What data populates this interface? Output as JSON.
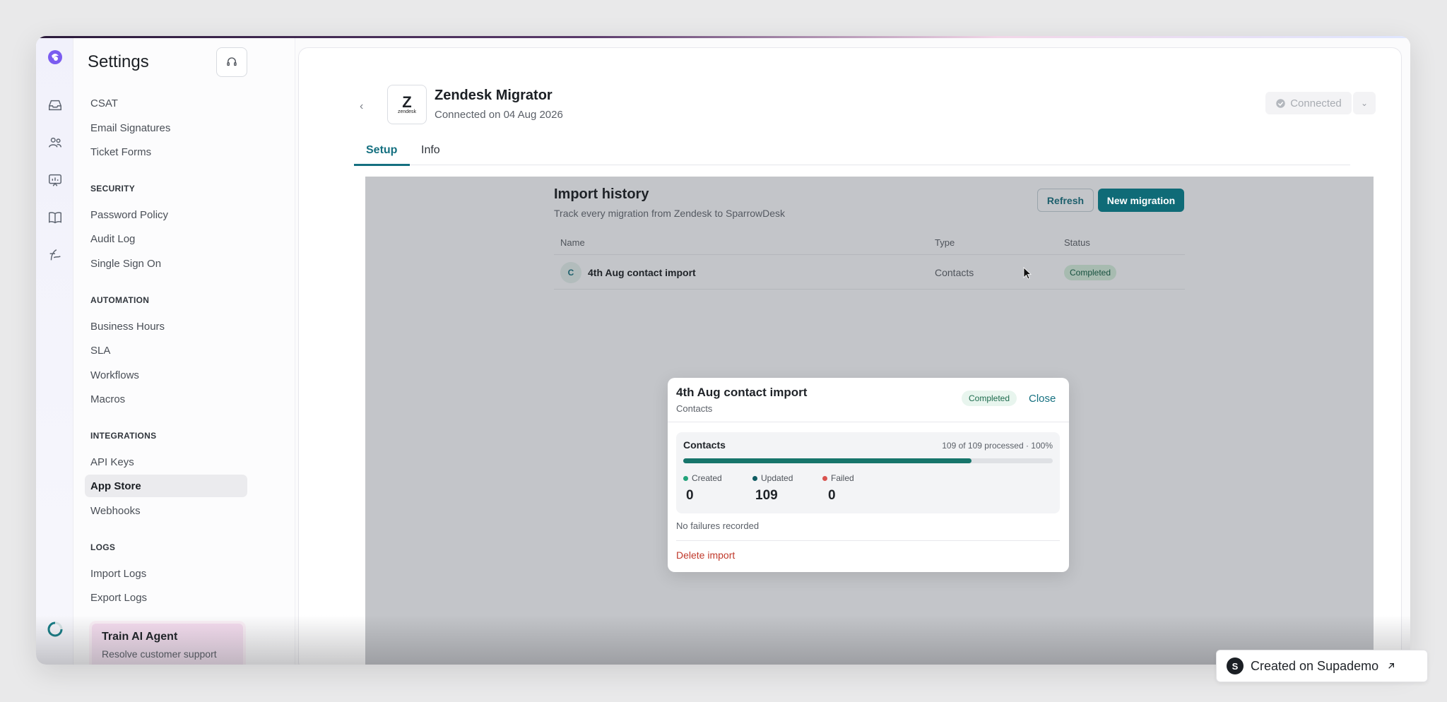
{
  "sidebar": {
    "title": "Settings",
    "top_items": [
      "CSAT",
      "Email Signatures",
      "Ticket Forms"
    ],
    "sections": [
      {
        "heading": "SECURITY",
        "items": [
          "Password Policy",
          "Audit Log",
          "Single Sign On"
        ]
      },
      {
        "heading": "AUTOMATION",
        "items": [
          "Business Hours",
          "SLA",
          "Workflows",
          "Macros"
        ]
      },
      {
        "heading": "INTEGRATIONS",
        "items": [
          "API Keys",
          "App Store",
          "Webhooks"
        ]
      },
      {
        "heading": "LOGS",
        "items": [
          "Import Logs",
          "Export Logs"
        ]
      }
    ],
    "active_item": "App Store",
    "ai_card": {
      "title": "Train AI Agent",
      "subtitle": "Resolve customer support"
    }
  },
  "app": {
    "logo_mark": "Z",
    "logo_name": "zendesk",
    "title": "Zendesk Migrator",
    "subtitle": "Connected on 04 Aug 2026",
    "status_button": "Connected"
  },
  "tabs": [
    {
      "label": "Setup"
    },
    {
      "label": "Info"
    }
  ],
  "import_history": {
    "title": "Import history",
    "subtitle": "Track every migration from Zendesk to SparrowDesk",
    "refresh_label": "Refresh",
    "new_label": "New migration",
    "columns": [
      "Name",
      "Type",
      "Status"
    ],
    "rows": [
      {
        "avatar": "C",
        "name": "4th Aug contact import",
        "type": "Contacts",
        "status": "Completed"
      }
    ]
  },
  "modal": {
    "title": "4th Aug contact import",
    "subtitle": "Contacts",
    "badge": "Completed",
    "close_label": "Close",
    "box_title": "Contacts",
    "processed_text": "109 of 109 processed · 100%",
    "progress_fraction": 0.78,
    "stats": [
      {
        "label": "Created",
        "value": "0",
        "color": "#22a37a"
      },
      {
        "label": "Updated",
        "value": "109",
        "color": "#0f5c62"
      },
      {
        "label": "Failed",
        "value": "0",
        "color": "#d9534f"
      }
    ],
    "no_failures": "No failures recorded",
    "delete_label": "Delete import"
  },
  "badge": {
    "logo": "S",
    "text": "Created on Supademo"
  },
  "colors": {
    "accent": "#157080",
    "primary_button": "#0f6b77",
    "danger": "#c0392b"
  }
}
